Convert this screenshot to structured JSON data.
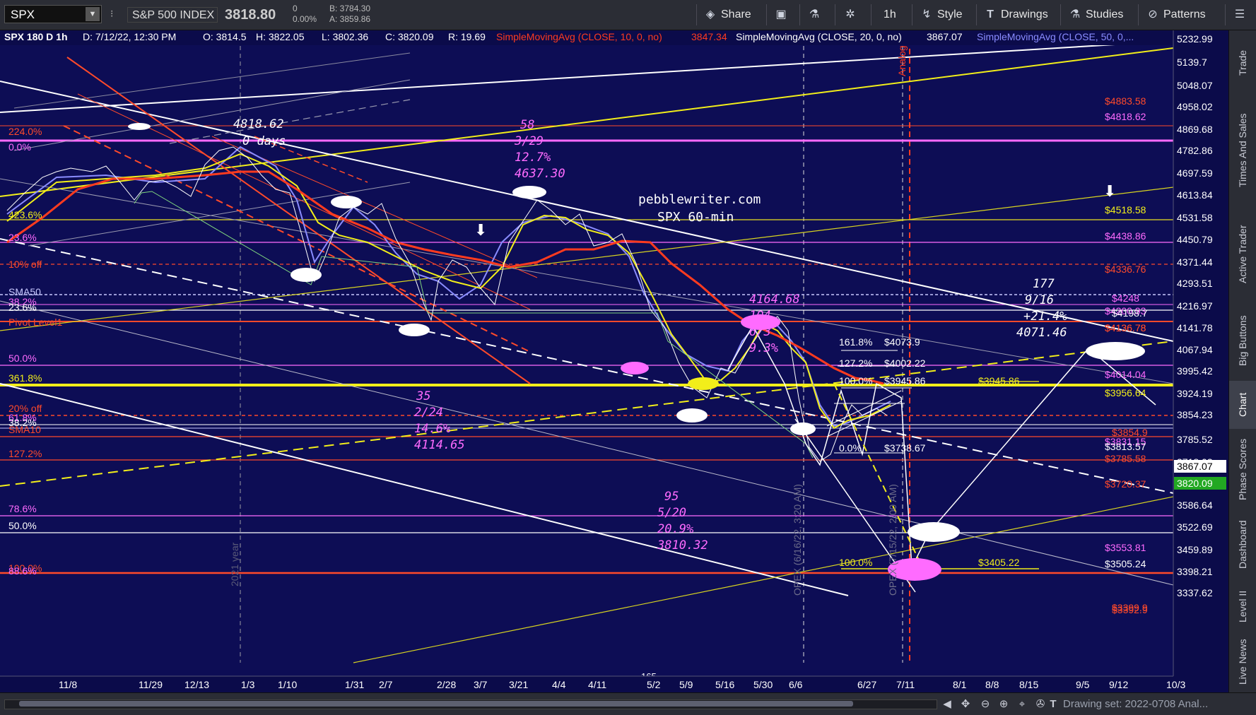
{
  "toolbar": {
    "symbol": "SPX",
    "index_name": "S&P 500 INDEX",
    "last_price": "3818.80",
    "change": "0",
    "change_pct": "0.00%",
    "bid": "B: 3784.30",
    "ask": "A: 3859.86",
    "share_label": "Share",
    "timeframe_label": "1h",
    "style_label": "Style",
    "drawings_label": "Drawings",
    "studies_label": "Studies",
    "patterns_label": "Patterns"
  },
  "legend": {
    "symbol_period": "SPX 180 D 1h",
    "date": "D: 7/12/22, 12:30 PM",
    "open": "O: 3814.5",
    "high": "H: 3822.05",
    "low": "L: 3802.36",
    "close": "C: 3820.09",
    "range": "R: 19.69",
    "sma10_label": "SimpleMovingAvg (CLOSE, 10, 0, no)",
    "sma10_value": "3847.34",
    "sma20_label": "SimpleMovingAvg (CLOSE, 20, 0, no)",
    "sma20_value": "3867.07",
    "sma50_label": "SimpleMovingAvg (CLOSE, 50, 0,..."
  },
  "price_axis": {
    "ticks": [
      "5232.99",
      "5139.7",
      "5048.07",
      "4958.02",
      "4869.68",
      "4782.86",
      "4697.59",
      "4613.84",
      "4531.58",
      "4450.79",
      "4371.44",
      "4293.51",
      "4216.97",
      "4141.78",
      "4067.94",
      "3995.42",
      "3924.19",
      "3854.23",
      "3785.52",
      "3718.03",
      "3651.74",
      "3586.64",
      "3522.69",
      "3459.89",
      "3398.21",
      "3337.62"
    ],
    "current_sma20_badge": "3867.07",
    "current_price_badge": "3820.09"
  },
  "time_axis": {
    "labels": [
      "11/8",
      "11/29",
      "12/13",
      "1/3",
      "1/10",
      "1/31",
      "2/7",
      "2/28",
      "3/7",
      "3/21",
      "4/4",
      "4/11",
      "5/2",
      "5/9",
      "5/16",
      "5/30",
      "6/6",
      "6/27",
      "7/11",
      "8/1",
      "8/8",
      "8/15",
      "9/5",
      "9/12",
      "10/3"
    ]
  },
  "left_levels": [
    "224.0%",
    "0.0%",
    "423.6%",
    "23.6%",
    "10% off",
    "SMA50",
    "38.2%",
    "23.6%",
    "Pivot Level1",
    "50.0%",
    "361.8%",
    "20% off",
    "61.8%",
    "38.2%",
    "SMA10",
    "127.2%",
    "78.6%",
    "50.0%",
    "100.0%",
    "88.6%"
  ],
  "right_levels": [
    "$4883.58",
    "$4818.62",
    "$4518.58",
    "$4438.86",
    "$4336.76",
    "$4248",
    "$4200.93",
    "$4198.7",
    "$4136.78",
    "$4136.78",
    "$4014.04",
    "$3956.64",
    "$3854.9",
    "$3831.15",
    "$3813.57",
    "$3785.58",
    "$3720.37",
    "$3553.81",
    "$3505.24",
    "$3399.9",
    "$3392.9"
  ],
  "annotations": {
    "high_price": "4818.62",
    "high_days": "0 days",
    "site": "pebblewriter.com",
    "chart_desc": "SPX 60-min",
    "a1_days": "58",
    "a1_date": "3/29",
    "a1_pct": "12.7%",
    "a1_price": "4637.30",
    "a2_days": "35",
    "a2_date": "2/24",
    "a2_pct": "14.6%",
    "a2_price": "4114.65",
    "a3_price": "4164.68",
    "a3_days": "104",
    "a3_date": "6/3",
    "a3_pct": "9.3%",
    "a4_days": "95",
    "a4_date": "5/20",
    "a4_pct": "20.9%",
    "a4_price": "3810.32",
    "a5_days": "177",
    "a5_date": "9/16",
    "a5_pct": "+21.4%",
    "a5_price": "4071.46",
    "fib_1618": "161.8%",
    "fib_1618_val": "$4073.9",
    "fib_1272": "127.2%",
    "fib_1272_val": "$4002.22",
    "fib_100": "100.0%",
    "fib_100_val": "$3945.86",
    "fib_0": "0.0%",
    "fib_0_val": "$3738.67",
    "mid_level_val": "$3945.86",
    "low_pct": "100.0%",
    "low_val": "$3405.22",
    "analog": "Analog",
    "year_marker": "2021 year",
    "opex1": "OPEX (6/16/22, 3:20 AM)",
    "opex2": "OPEX (7/15/22, 2:00 AM)",
    "partial_num": "165"
  },
  "sidebar": {
    "tabs": [
      "Trade",
      "Times And Sales",
      "Active Trader",
      "Big Buttons",
      "Chart",
      "Phase Scores",
      "Dashboard",
      "Level II",
      "Live News"
    ]
  },
  "bottom": {
    "drawing_set": "Drawing set: 2022-0708 Anal..."
  },
  "colors": {
    "background": "#0b0b4a",
    "sma10": "#ff3b1f",
    "sma20": "#f2ee1a",
    "sma50": "#8a8cff",
    "fib_magenta": "#ff6bff",
    "level_red": "#ff4a2a"
  }
}
